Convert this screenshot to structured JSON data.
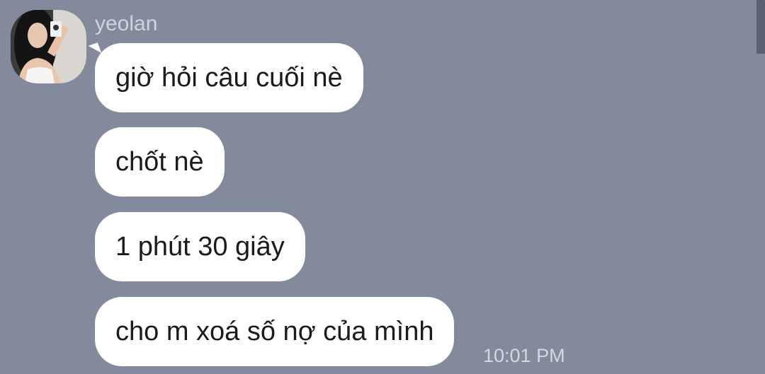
{
  "contact": {
    "name": "yeolan",
    "avatar_icon": "profile-photo"
  },
  "messages": [
    {
      "text": "giờ hỏi câu cuối nè"
    },
    {
      "text": "chốt nè"
    },
    {
      "text": "1 phút 30 giây"
    },
    {
      "text": "cho m xoá số nợ của mình"
    }
  ],
  "last_timestamp": "10:01 PM",
  "colors": {
    "background": "#828a9c",
    "bubble": "#ffffff",
    "text": "#1b1b1b",
    "meta_text": "#d4d8df"
  }
}
